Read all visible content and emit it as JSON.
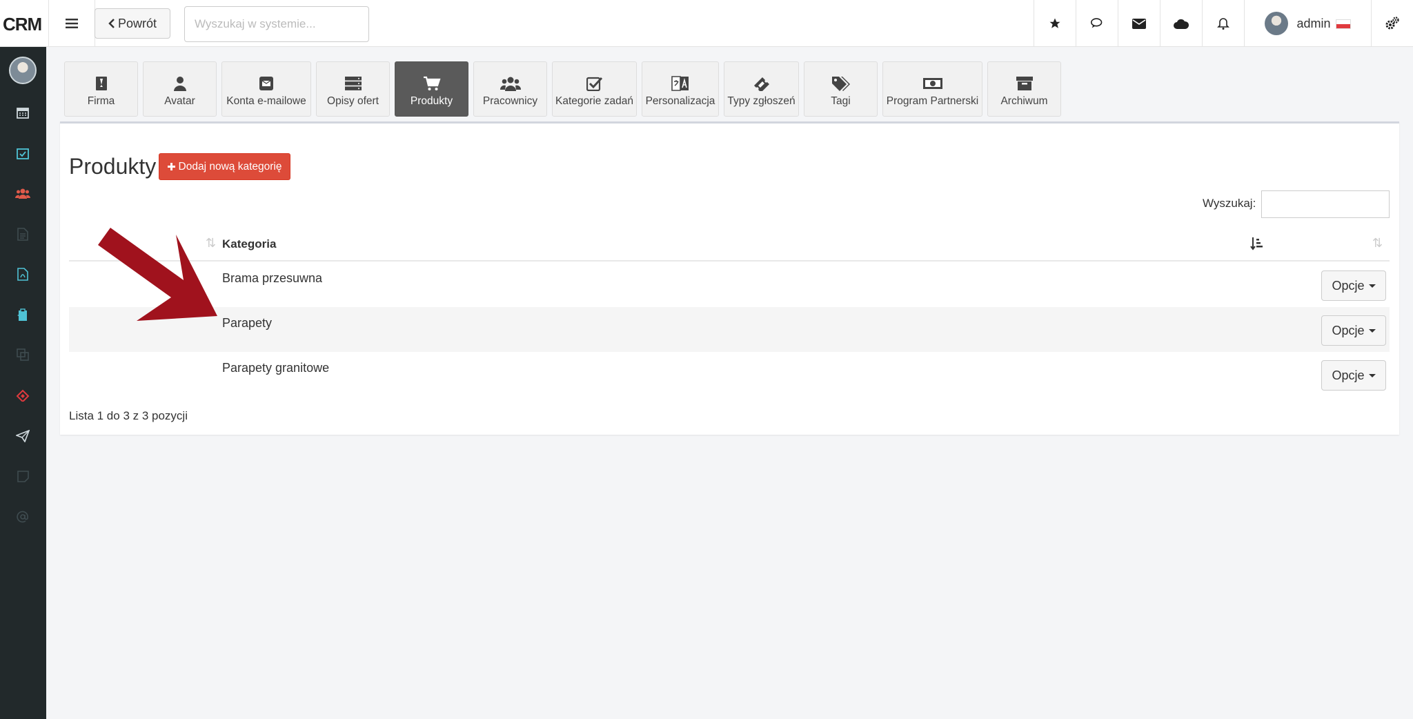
{
  "header": {
    "logo": "CRM",
    "back_label": "Powrót",
    "search_placeholder": "Wyszukaj w systemie...",
    "username": "admin",
    "icons": [
      "star-icon",
      "comments-icon",
      "envelope-icon",
      "cloud-icon",
      "bell-icon",
      "cogs-icon"
    ]
  },
  "sidebar": {
    "icons": [
      "calendar-icon",
      "calendar-check-icon",
      "users-icon",
      "file-icon",
      "pdf-file-icon",
      "clipboard-icon",
      "copy-icon",
      "ticket-icon",
      "paper-plane-icon",
      "sticky-note-icon",
      "at-icon"
    ]
  },
  "tabs": [
    {
      "label": "Firma",
      "icon": "id-badge-icon"
    },
    {
      "label": "Avatar",
      "icon": "user-icon"
    },
    {
      "label": "Konta e-mailowe",
      "icon": "envelope-square-icon"
    },
    {
      "label": "Opisy ofert",
      "icon": "server-icon"
    },
    {
      "label": "Produkty",
      "icon": "shopping-cart-icon",
      "active": true
    },
    {
      "label": "Pracownicy",
      "icon": "users-icon"
    },
    {
      "label": "Kategorie zadań",
      "icon": "check-square-icon"
    },
    {
      "label": "Personalizacja",
      "icon": "language-icon"
    },
    {
      "label": "Typy zgłoszeń",
      "icon": "ticket-icon"
    },
    {
      "label": "Tagi",
      "icon": "tags-icon"
    },
    {
      "label": "Program Partnerski",
      "icon": "money-icon"
    },
    {
      "label": "Archiwum",
      "icon": "archive-icon"
    }
  ],
  "main": {
    "title": "Produkty",
    "add_button": "Dodaj nową kategorię",
    "search_label": "Wyszukaj:",
    "column_header": "Kategoria",
    "rows": [
      {
        "label": "Brama przesuwna",
        "options": "Opcje"
      },
      {
        "label": "Parapety",
        "options": "Opcje"
      },
      {
        "label": "Parapety granitowe",
        "options": "Opcje"
      }
    ],
    "footer": "Lista 1 do 3 z 3 pozycji"
  },
  "colors": {
    "sidebar_bg": "#22292b",
    "accent_red": "#dd4b39",
    "active_tab": "#5a5a5a",
    "annotation_arrow": "#a0121d"
  }
}
